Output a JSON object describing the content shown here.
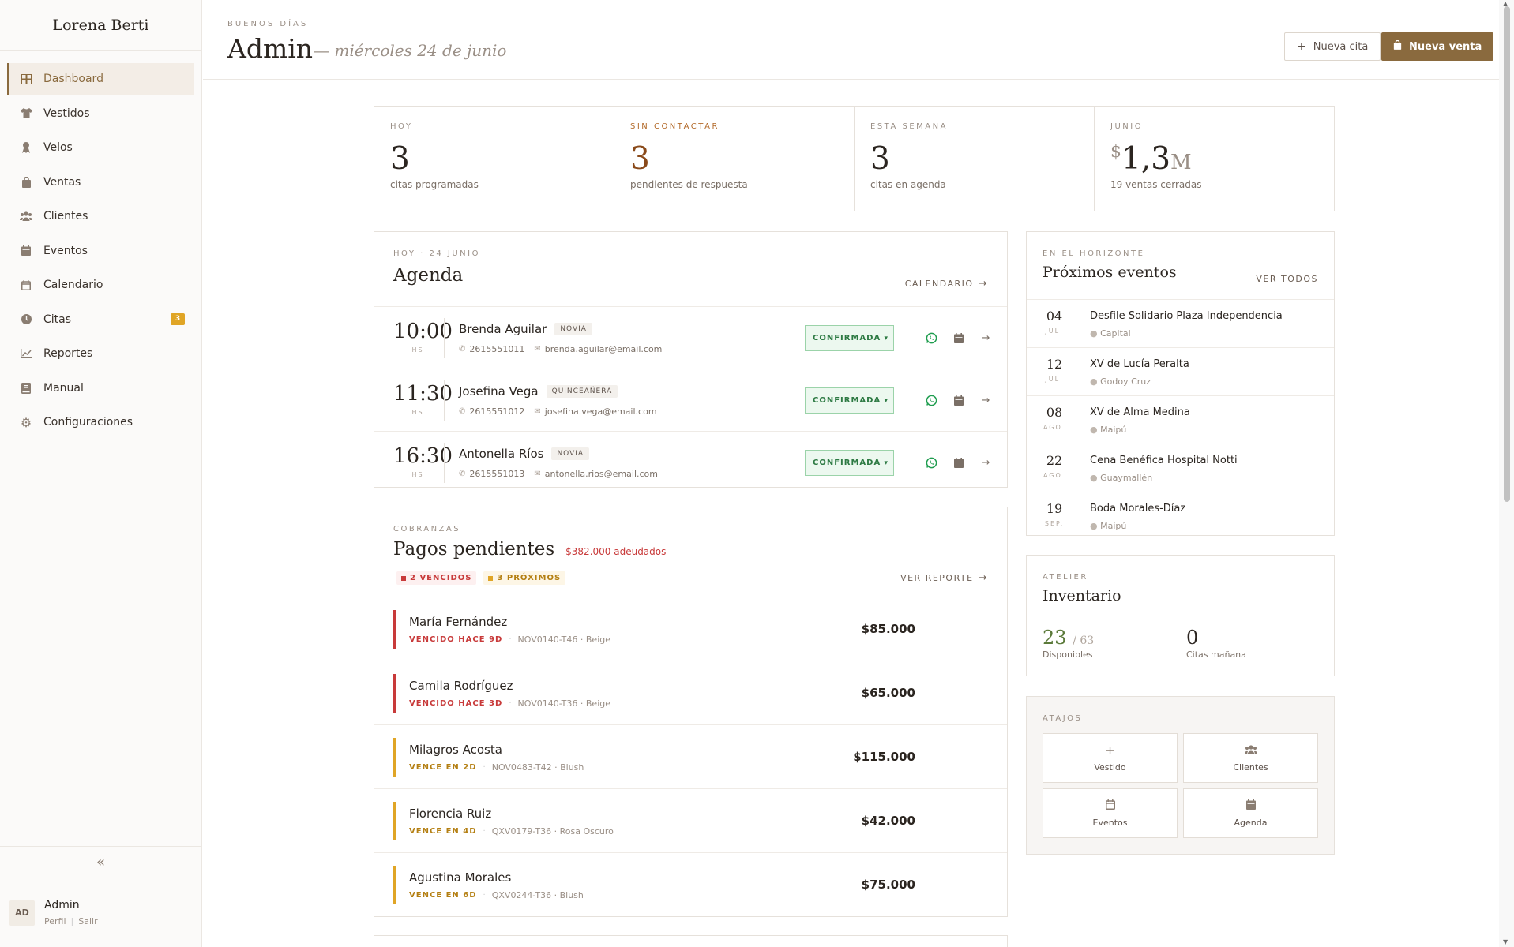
{
  "sidebar": {
    "brand": "Lorena Berti",
    "items": [
      {
        "label": "Dashboard",
        "icon": "grid-icon",
        "active": true
      },
      {
        "label": "Vestidos",
        "icon": "shirt-icon"
      },
      {
        "label": "Velos",
        "icon": "veil-icon"
      },
      {
        "label": "Ventas",
        "icon": "bag-icon"
      },
      {
        "label": "Clientes",
        "icon": "users-icon"
      },
      {
        "label": "Eventos",
        "icon": "calendar-grid-icon"
      },
      {
        "label": "Calendario",
        "icon": "calendar-icon"
      },
      {
        "label": "Citas",
        "icon": "clock-icon",
        "badge": "3"
      },
      {
        "label": "Reportes",
        "icon": "chart-line-icon"
      },
      {
        "label": "Manual",
        "icon": "book-icon"
      },
      {
        "label": "Configuraciones",
        "icon": "gear-icon"
      }
    ],
    "user": {
      "initials": "AD",
      "name": "Admin",
      "profile_link": "Perfil",
      "logout_link": "Salir"
    }
  },
  "header": {
    "greeting": "BUENOS DÍAS",
    "title": "Admin",
    "date": "— miércoles 24 de junio",
    "new_appointment": "Nueva cita",
    "new_sale": "Nueva venta"
  },
  "stats": [
    {
      "label": "HOY",
      "value": "3",
      "desc": "citas programadas"
    },
    {
      "label": "SIN CONTACTAR",
      "value": "3",
      "desc": "pendientes de respuesta"
    },
    {
      "label": "ESTA SEMANA",
      "value": "3",
      "desc": "citas en agenda"
    },
    {
      "label": "JUNIO",
      "currency": "$",
      "value": "1,3",
      "unit": "M",
      "desc": "19 ventas cerradas"
    }
  ],
  "agenda": {
    "eyebrow": "HOY · 24 JUNIO",
    "title": "Agenda",
    "link": "CALENDARIO",
    "appointments": [
      {
        "time": "10:00",
        "hs": "HS",
        "name": "Brenda Aguilar",
        "tag": "NOVIA",
        "phone": "2615551011",
        "email": "brenda.aguilar@email.com",
        "status": "CONFIRMADA"
      },
      {
        "time": "11:30",
        "hs": "HS",
        "name": "Josefina Vega",
        "tag": "QUINCEAÑERA",
        "phone": "2615551012",
        "email": "josefina.vega@email.com",
        "status": "CONFIRMADA"
      },
      {
        "time": "16:30",
        "hs": "HS",
        "name": "Antonella Ríos",
        "tag": "NOVIA",
        "phone": "2615551013",
        "email": "antonella.rios@email.com",
        "status": "CONFIRMADA"
      }
    ]
  },
  "payments": {
    "eyebrow": "COBRANZAS",
    "title": "Pagos pendientes",
    "owed": "$382.000 adeudados",
    "overdue_chip": "2 VENCIDOS",
    "upcoming_chip": "3 PRÓXIMOS",
    "link": "VER REPORTE",
    "items": [
      {
        "name": "María Fernández",
        "status": "VENCIDO HACE 9D",
        "code": "NOV0140-T46 · Beige",
        "amount": "$85.000",
        "kind": "overdue"
      },
      {
        "name": "Camila Rodríguez",
        "status": "VENCIDO HACE 3D",
        "code": "NOV0140-T36 · Beige",
        "amount": "$65.000",
        "kind": "overdue"
      },
      {
        "name": "Milagros Acosta",
        "status": "VENCE EN 2D",
        "code": "NOV0483-T42 · Blush",
        "amount": "$115.000",
        "kind": "upcoming"
      },
      {
        "name": "Florencia Ruiz",
        "status": "VENCE EN 4D",
        "code": "QXV0179-T36 · Rosa Oscuro",
        "amount": "$42.000",
        "kind": "upcoming"
      },
      {
        "name": "Agustina Morales",
        "status": "VENCE EN 6D",
        "code": "QXV0244-T36 · Blush",
        "amount": "$75.000",
        "kind": "upcoming"
      }
    ]
  },
  "events": {
    "eyebrow": "EN EL HORIZONTE",
    "title": "Próximos eventos",
    "link": "VER TODOS",
    "items": [
      {
        "day": "04",
        "month": "JUL.",
        "name": "Desfile Solidario Plaza Independencia",
        "location": "Capital"
      },
      {
        "day": "12",
        "month": "JUL.",
        "name": "XV de Lucía Peralta",
        "location": "Godoy Cruz"
      },
      {
        "day": "08",
        "month": "AGO.",
        "name": "XV de Alma Medina",
        "location": "Maipú"
      },
      {
        "day": "22",
        "month": "AGO.",
        "name": "Cena Benéfica Hospital Notti",
        "location": "Guaymallén"
      },
      {
        "day": "19",
        "month": "SEP.",
        "name": "Boda Morales-Díaz",
        "location": "Maipú"
      }
    ]
  },
  "inventory": {
    "eyebrow": "ATELIER",
    "title": "Inventario",
    "available": "23",
    "total": "/ 63",
    "available_label": "Disponibles",
    "tomorrow": "0",
    "tomorrow_label": "Citas mañana"
  },
  "shortcuts": {
    "eyebrow": "ATAJOS",
    "items": [
      {
        "label": "Vestido",
        "icon": "plus-icon"
      },
      {
        "label": "Clientes",
        "icon": "users-icon"
      },
      {
        "label": "Eventos",
        "icon": "calendar-icon"
      },
      {
        "label": "Agenda",
        "icon": "calendar-grid-icon"
      }
    ]
  },
  "colors": {
    "brand": "#8a6a3e",
    "overdue": "#c83a3a",
    "upcoming": "#e0a526",
    "confirmed": "#2d7a43"
  }
}
